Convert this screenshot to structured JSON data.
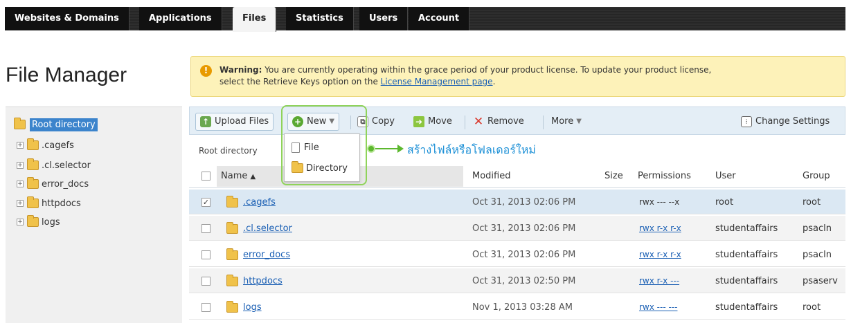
{
  "nav": {
    "tabs": [
      {
        "label": "Websites & Domains"
      },
      {
        "label": "Applications"
      },
      {
        "label": "Files"
      },
      {
        "label": "Statistics"
      },
      {
        "label": "Users"
      },
      {
        "label": "Account"
      }
    ],
    "active_tab": "Files"
  },
  "page_title": "File Manager",
  "warning": {
    "bold": "Warning:",
    "text1": " You are currently operating within the grace period of your product license. To update your product license,",
    "text2": "select the Retrieve Keys option on the ",
    "link": "License Management page",
    "text3": "."
  },
  "tree": {
    "root": "Root directory",
    "items": [
      ".cagefs",
      ".cl.selector",
      "error_docs",
      "httpdocs",
      "logs"
    ]
  },
  "toolbar": {
    "upload": "Upload Files",
    "new": "New",
    "copy": "Copy",
    "move": "Move",
    "remove": "Remove",
    "more": "More",
    "settings": "Change Settings"
  },
  "breadcrumb": "Root directory",
  "new_menu": {
    "file": "File",
    "directory": "Directory"
  },
  "callout": "สร้างไฟล์หรือโฟลเดอร์ใหม่",
  "table": {
    "headers": {
      "name": "Name",
      "sort_indicator": "▲",
      "modified": "Modified",
      "size": "Size",
      "permissions": "Permissions",
      "user": "User",
      "group": "Group"
    },
    "rows": [
      {
        "name": ".cagefs",
        "modified": "Oct 31, 2013 02:06 PM",
        "permissions": "rwx --- --x",
        "user": "root",
        "group": "root",
        "checked": "✓"
      },
      {
        "name": ".cl.selector",
        "modified": "Oct 31, 2013 02:06 PM",
        "permissions": "rwx r-x r-x",
        "user": "studentaffairs",
        "group": "psacln",
        "checked": ""
      },
      {
        "name": "error_docs",
        "modified": "Oct 31, 2013 02:06 PM",
        "permissions": "rwx r-x r-x",
        "user": "studentaffairs",
        "group": "psacln",
        "checked": ""
      },
      {
        "name": "httpdocs",
        "modified": "Oct 31, 2013 02:50 PM",
        "permissions": "rwx r-x ---",
        "user": "studentaffairs",
        "group": "psaserv",
        "checked": ""
      },
      {
        "name": "logs",
        "modified": "Nov 1, 2013 03:28 AM",
        "permissions": "rwx --- ---",
        "user": "studentaffairs",
        "group": "root",
        "checked": ""
      }
    ]
  },
  "colors": {
    "accent": "#3c84cc",
    "link": "#1a5fb4",
    "warning_bg": "#fdf2b9",
    "callout": "#5cb82e"
  }
}
